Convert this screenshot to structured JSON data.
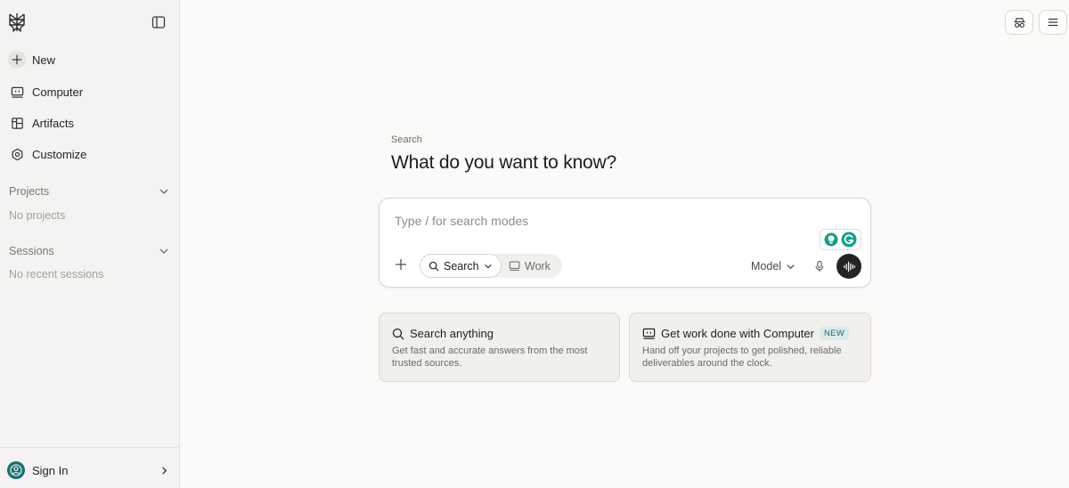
{
  "sidebar": {
    "nav": [
      {
        "label": "New",
        "icon": "plus-icon"
      },
      {
        "label": "Computer",
        "icon": "computer-icon"
      },
      {
        "label": "Artifacts",
        "icon": "artifacts-icon"
      },
      {
        "label": "Customize",
        "icon": "customize-icon"
      }
    ],
    "projects": {
      "label": "Projects",
      "empty": "No projects"
    },
    "sessions": {
      "label": "Sessions",
      "empty": "No recent sessions"
    },
    "signin_label": "Sign In"
  },
  "main": {
    "eyebrow": "Search",
    "headline": "What do you want to know?",
    "composer": {
      "placeholder": "Type / for search modes",
      "value": "",
      "mode_search_label": "Search",
      "mode_work_label": "Work",
      "model_label": "Model"
    },
    "cards": [
      {
        "title": "Search anything",
        "description": "Get fast and accurate answers from the most trusted sources.",
        "icon": "search-icon"
      },
      {
        "title": "Get work done with Computer",
        "badge": "NEW",
        "description": "Hand off your projects to get polished, reliable deliverables around the clock.",
        "icon": "computer-icon"
      }
    ]
  },
  "colors": {
    "accent_teal": "#1f6f72",
    "sidebar_bg": "#f4f3f1",
    "page_bg": "#fbfaf8",
    "voice_button": "#262422",
    "grammarly_green": "#15a085"
  }
}
